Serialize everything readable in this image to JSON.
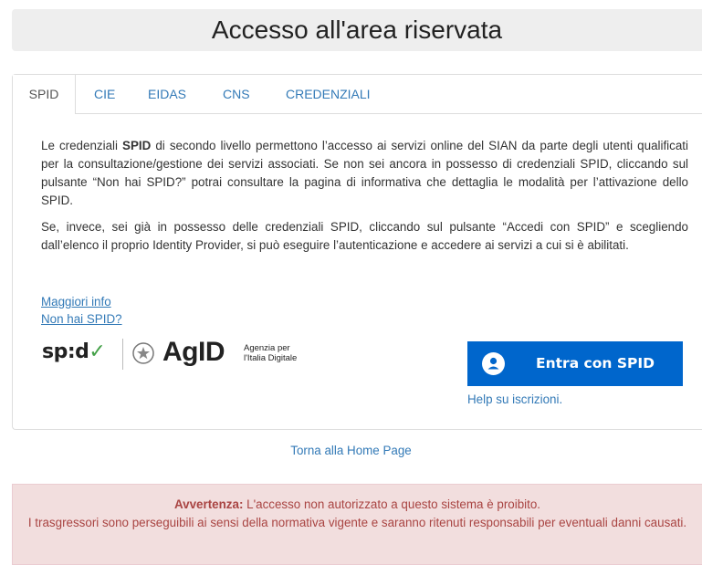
{
  "page": {
    "title": "Accesso all'area riservata"
  },
  "tabs": [
    {
      "label": "SPID",
      "active": true
    },
    {
      "label": "CIE",
      "active": false
    },
    {
      "label": "EIDAS",
      "active": false
    },
    {
      "label": "CNS",
      "active": false
    },
    {
      "label": "CREDENZIALI",
      "active": false
    }
  ],
  "content": {
    "p1_before": "Le credenziali ",
    "p1_bold": "SPID",
    "p1_after": " di secondo livello permettono l’accesso ai servizi online del SIAN da parte degli utenti qualificati per la consultazione/gestione dei servizi associati. Se non sei ancora in possesso di credenziali SPID, cliccando sul pulsante “Non hai SPID?” potrai consultare la pagina di informativa che dettaglia le modalità per l’attivazione dello SPID.",
    "p2": "Se, invece, sei già in possesso delle credenziali SPID, cliccando sul pulsante “Accedi con SPID” e scegliendo dall’elenco il proprio Identity Provider, si può eseguire l’autenticazione e accedere ai servizi a cui si è abilitati.",
    "link_info": "Maggiori info",
    "link_no_spid": "Non hai SPID?"
  },
  "logos": {
    "spid_text": "sp:d",
    "spid_check": "✓",
    "agid_text": "AgID",
    "agid_sub_line1": "Agenzia per",
    "agid_sub_line2": "l'Italia Digitale"
  },
  "login": {
    "button_label": "Entra con SPID",
    "help_label": "Help su iscrizioni."
  },
  "footer": {
    "home_link": "Torna alla Home Page"
  },
  "alert": {
    "bold": "Avvertenza:",
    "line1": " L'accesso non autorizzato a questo sistema è proibito.",
    "line2": "I trasgressori sono perseguibili ai sensi della normativa vigente e saranno ritenuti responsabili per eventuali danni causati."
  },
  "colors": {
    "link": "#337ab7",
    "spid_button": "#0066cc",
    "alert_bg": "#f2dede",
    "alert_text": "#a94442"
  }
}
